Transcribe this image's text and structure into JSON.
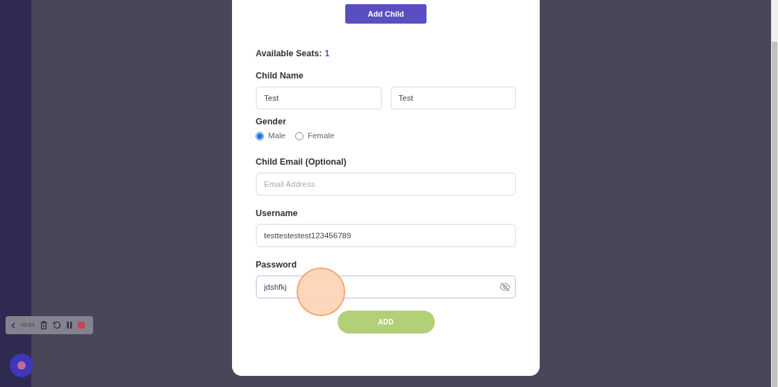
{
  "dialog": {
    "add_child_button": "Add Child",
    "seats_label": "Available Seats:",
    "seats_value": "1",
    "child_name": {
      "label": "Child Name",
      "fields": [
        {
          "value": "Test"
        },
        {
          "value": "Test"
        }
      ]
    },
    "gender": {
      "label": "Gender",
      "options": [
        {
          "label": "Male",
          "selected": true
        },
        {
          "label": "Female",
          "selected": false
        }
      ]
    },
    "email": {
      "label": "Child Email (Optional)",
      "placeholder": "Email Address"
    },
    "username": {
      "label": "Username",
      "value": "testtestestest123456789"
    },
    "password": {
      "label": "Password",
      "value": "jdshfkj",
      "focused": true
    },
    "submit_button": "ADD"
  },
  "recorder": {
    "time": "00:53"
  }
}
